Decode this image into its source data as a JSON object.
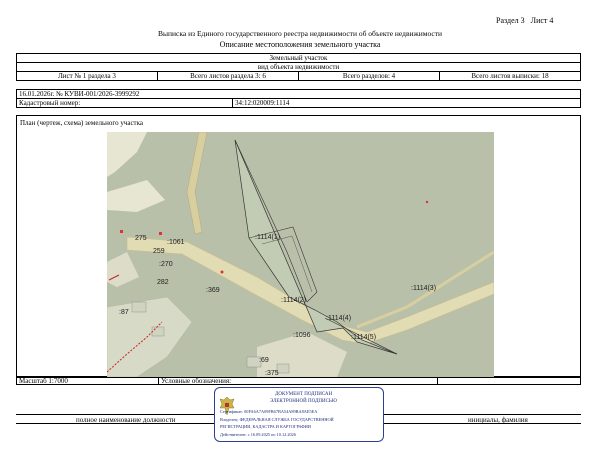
{
  "header": {
    "section": "Раздел 3",
    "sheet": "Лист 4",
    "title": "Выписка из Единого государственного реестра недвижимости об объекте недвижимости",
    "subtitle": "Описание местоположения земельного участка"
  },
  "object_type": "Земельный участок",
  "object_kind_caption": "вид объекта недвижимости",
  "sheet_info": {
    "sheet_of_section": "Лист № 1 раздела 3",
    "section_sheets": "Всего листов раздела 3: 6",
    "total_sections": "Всего разделов: 4",
    "total_sheets": "Всего листов выписки: 18"
  },
  "date_number": "16.01.2026г. № КУВИ-001/2026-3999292",
  "cadastral": {
    "label": "Кадастровый номер:",
    "value": "34:12:020009:1114"
  },
  "plan_caption": "План (чертеж, схема) земельного участка",
  "map_labels": {
    "l1114_1": ":1114(1)",
    "l1114_2": ":1114(2)",
    "l1114_3": ":1114(3)",
    "l1114_4": ":1114(4)",
    "l1114_5": ":1114(5)",
    "l275": "275",
    "l1061": ":1061",
    "l259": "259",
    "l270": ":270",
    "l282": "282",
    "l369": ":369",
    "l87": ":87",
    "l1096": ":1096",
    "l69": ":69",
    "l375": ":375"
  },
  "scale": "Масштаб 1:7000",
  "legend": "Условные обозначения:",
  "signature_row": {
    "position": "полное наименование должности",
    "name": "инициалы, фамилия"
  },
  "stamp": {
    "line1": "ДОКУМЕНТ ПОДПИСАН",
    "line2": "ЭЛЕКТРОННОЙ ПОДПИСЬЮ",
    "cert": "Сертификат: 00FA6A7A09FB67BA54A89BA8AE5EA",
    "owner1": "Владелец: ФЕДЕРАЛЬНАЯ СЛУЖБА ГОСУДАРСТВЕННОЙ",
    "owner2": "РЕГИСТРАЦИИ, КАДАСТРА И КАРТОГРАФИИ",
    "valid": "Действителен: с 16.09.2025 по 10.12.2026"
  },
  "colors": {
    "map_background": "#b9c0a9",
    "parcel_fill": "#c2cbb4",
    "road": "#e2dcb4",
    "stamp_blue": "#2c3f92"
  }
}
